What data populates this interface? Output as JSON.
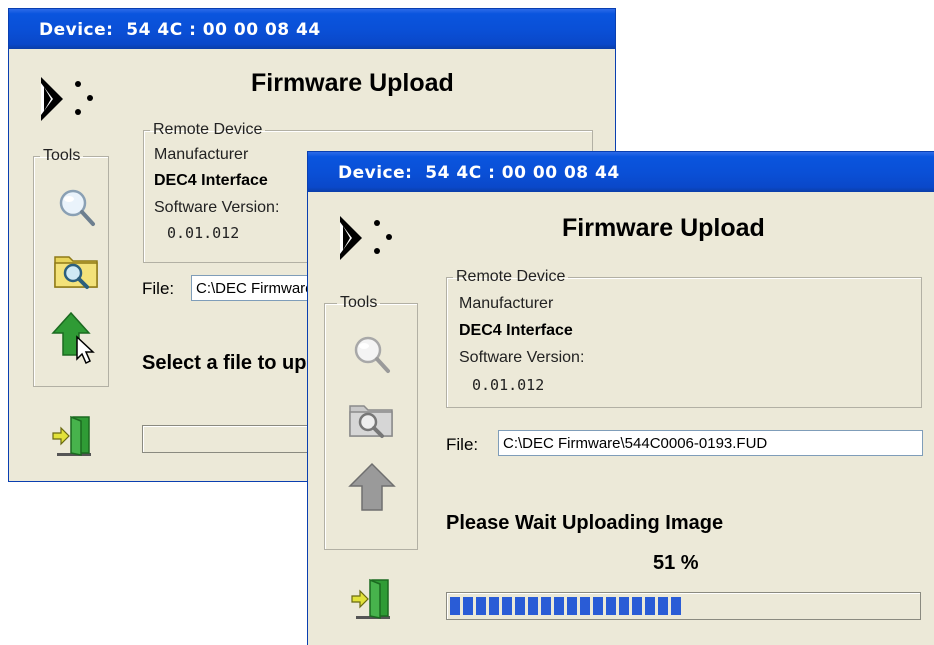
{
  "back_window": {
    "title": "Device:  54 4C : 00 00 08 44",
    "heading": "Firmware Upload",
    "tools_label": "Tools",
    "remote_device_label": "Remote Device",
    "manufacturer_label": "Manufacturer",
    "manufacturer_value": "DEC4 Interface",
    "software_version_label": "Software Version:",
    "software_version_value": "0.01.012",
    "file_label": "File:",
    "file_value": "C:\\DEC Firmware\\544C0006-0193.FUD",
    "status_text": "Select a file to upload",
    "icons": [
      "magnifier-icon",
      "folder-search-icon",
      "upload-arrow-icon",
      "exit-door-icon"
    ]
  },
  "front_window": {
    "title": "Device:  54 4C : 00 00 08 44",
    "heading": "Firmware Upload",
    "tools_label": "Tools",
    "remote_device_label": "Remote Device",
    "manufacturer_label": "Manufacturer",
    "manufacturer_value": "DEC4 Interface",
    "software_version_label": "Software Version:",
    "software_version_value": "0.01.012",
    "file_label": "File:",
    "file_value": "C:\\DEC Firmware\\544C0006-0193.FUD",
    "status_text": "Please Wait  Uploading Image",
    "percent_text": "51 %",
    "progress_fraction": 0.51,
    "icons": [
      "magnifier-icon",
      "folder-search-icon",
      "upload-arrow-icon",
      "exit-door-icon"
    ]
  },
  "colors": {
    "titlebar": "#0a4fd6",
    "dialog_bg": "#ece9d8",
    "progress_fill": "#2a5cd6"
  }
}
